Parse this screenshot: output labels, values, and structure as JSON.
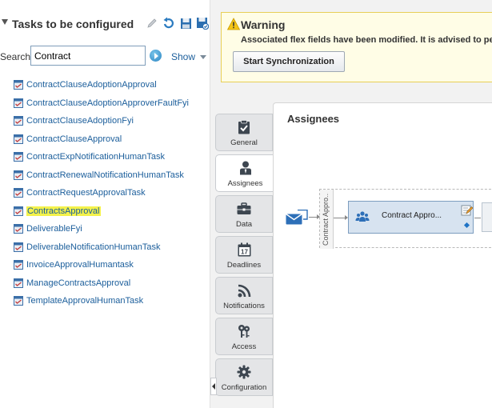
{
  "left_panel": {
    "title": "Tasks to be configured",
    "header_icons": [
      "pencil-icon",
      "refresh-icon",
      "save-icon",
      "commit-icon"
    ],
    "search": {
      "label": "Search",
      "value": "Contract",
      "show_label": "Show"
    },
    "tasks": [
      {
        "label": "ContractClauseAdoptionApproval",
        "selected": false
      },
      {
        "label": "ContractClauseAdoptionApproverFaultFyi",
        "selected": false
      },
      {
        "label": "ContractClauseAdoptionFyi",
        "selected": false
      },
      {
        "label": "ContractClauseApproval",
        "selected": false
      },
      {
        "label": "ContractExpNotificationHumanTask",
        "selected": false
      },
      {
        "label": "ContractRenewalNotificationHumanTask",
        "selected": false
      },
      {
        "label": "ContractRequestApprovalTask",
        "selected": false
      },
      {
        "label": "ContractsApproval",
        "selected": true
      },
      {
        "label": "DeliverableFyi",
        "selected": false
      },
      {
        "label": "DeliverableNotificationHumanTask",
        "selected": false
      },
      {
        "label": "InvoiceApprovalHumantask",
        "selected": false
      },
      {
        "label": "ManageContractsApproval",
        "selected": false
      },
      {
        "label": "TemplateApprovalHumanTask",
        "selected": false
      }
    ]
  },
  "warning": {
    "title": "Warning",
    "message": "Associated flex fields have been modified. It is advised to per",
    "button_label": "Start Synchronization"
  },
  "tabs": [
    {
      "label": "General",
      "icon": "clipboard-check-icon",
      "active": false
    },
    {
      "label": "Assignees",
      "icon": "person-icon",
      "active": true
    },
    {
      "label": "Data",
      "icon": "briefcase-icon",
      "active": false
    },
    {
      "label": "Deadlines",
      "icon": "calendar-icon",
      "active": false
    },
    {
      "label": "Notifications",
      "icon": "rss-icon",
      "active": false
    },
    {
      "label": "Access",
      "icon": "keys-icon",
      "active": false
    },
    {
      "label": "Configuration",
      "icon": "gear-icon",
      "active": false
    }
  ],
  "calendar_day": "17",
  "content": {
    "title": "Assignees",
    "lane_label": "Contract Appro...",
    "node_label": "Contract Appro..."
  },
  "colors": {
    "link": "#1b5e9b",
    "highlight": "#f4f24a",
    "warning_bg": "#fffde6",
    "warning_border": "#e8cf57",
    "node_fill": "#d7e3f0",
    "accent_blue": "#1f73c5"
  }
}
